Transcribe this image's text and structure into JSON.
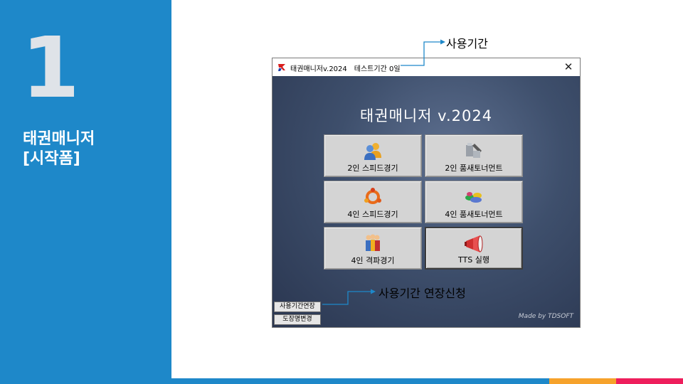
{
  "slide": {
    "number": "1",
    "title_line1": "태권매니저",
    "title_line2": "[시작폼]"
  },
  "window": {
    "title": "태권매니저v.2024",
    "trial": "테스트기간 0일",
    "close_glyph": "✕"
  },
  "app": {
    "heading": "태권매니저 v.2024",
    "buttons": [
      {
        "label": "2인 스피드경기",
        "icon": "users-icon"
      },
      {
        "label": "2인 품새토너먼트",
        "icon": "tools-icon"
      },
      {
        "label": "4인 스피드경기",
        "icon": "ring-icon"
      },
      {
        "label": "4인 품새토너먼트",
        "icon": "gems-icon"
      },
      {
        "label": "4인 격파경기",
        "icon": "team-icon"
      },
      {
        "label": "TTS 실행",
        "icon": "megaphone-icon"
      }
    ],
    "extend_button": "사용기간연장",
    "dojang_button": "도장명변경",
    "credit": "Made by TDSOFT"
  },
  "annotations": {
    "usage_period": "사용기간",
    "usage_extend_request": "사용기간 연장신청"
  },
  "colors": {
    "panel_blue": "#1e88c9",
    "accent_orange": "#f6a22b",
    "accent_red": "#ee1e5c"
  }
}
